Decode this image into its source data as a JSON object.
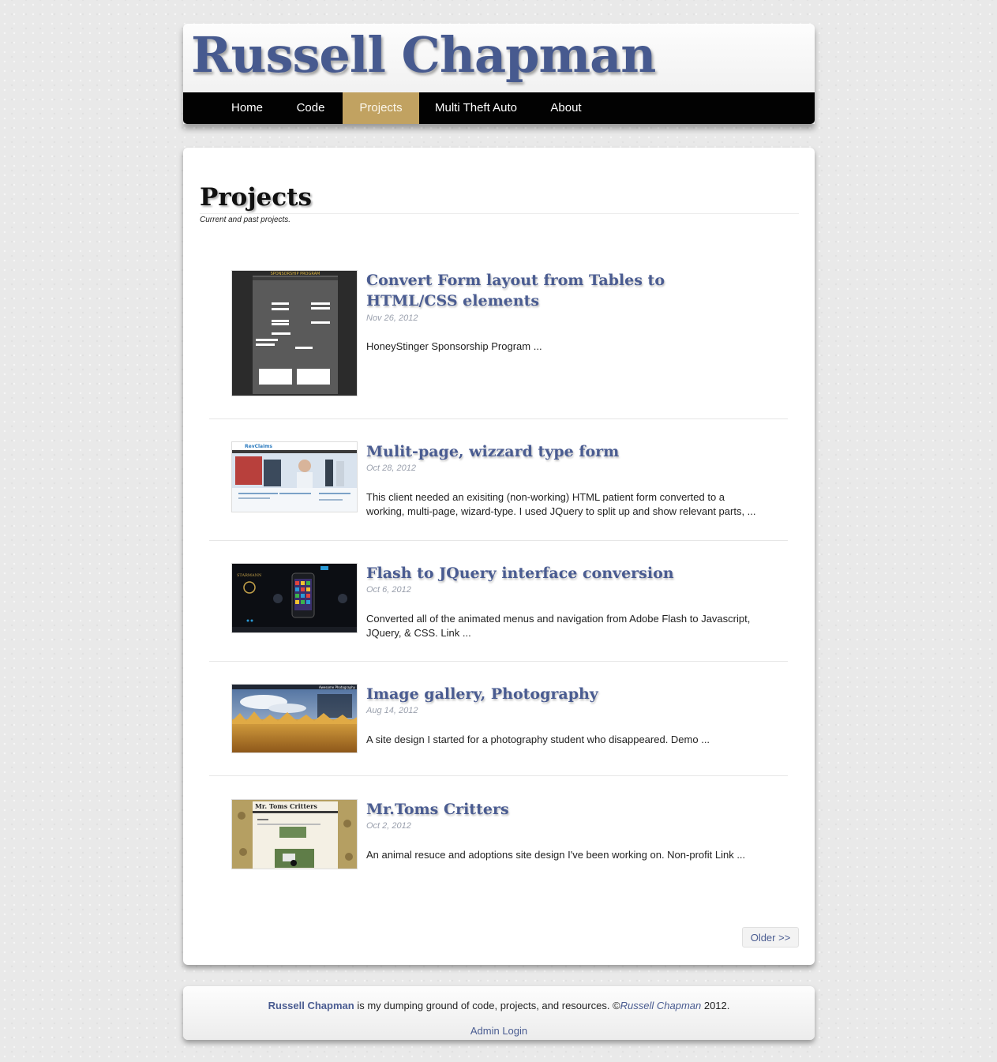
{
  "site": {
    "title": "Russell Chapman"
  },
  "nav": {
    "items": [
      {
        "label": "Home"
      },
      {
        "label": "Code"
      },
      {
        "label": "Projects",
        "active": true
      },
      {
        "label": "Multi Theft Auto"
      },
      {
        "label": "About"
      }
    ]
  },
  "page": {
    "title": "Projects",
    "subtitle": "Current and past projects."
  },
  "posts": [
    {
      "title": "Convert Form layout from Tables to HTML/CSS elements",
      "date": "Nov 26, 2012",
      "excerpt": "HoneyStinger Sponsorship Program ...",
      "thumb_text": "SPONSORSHIP PROGRAM"
    },
    {
      "title": "Mulit-page, wizzard type form",
      "date": "Oct 28, 2012",
      "excerpt": "This client needed an exisiting (non-working) HTML patient form converted to a working, multi-page, wizard-type. I used JQuery to split up and show relevant parts, ...",
      "thumb_text": "RevClaims"
    },
    {
      "title": "Flash to JQuery interface conversion",
      "date": "Oct 6, 2012",
      "excerpt": "Converted all of the animated menus and navigation from Adobe Flash to Javascript, JQuery, & CSS. Link ...",
      "thumb_text": "STARMANN"
    },
    {
      "title": "Image gallery, Photography",
      "date": "Aug 14, 2012",
      "excerpt": "A site design I started for a photography student who disappeared. Demo ...",
      "thumb_text": "Awesome Photography"
    },
    {
      "title": "Mr.Toms Critters",
      "date": "Oct 2, 2012",
      "excerpt": "An animal resuce and adoptions site design I've been working on. Non-profit Link ...",
      "thumb_text": "Mr. Toms Critters"
    }
  ],
  "pagination": {
    "older_label": "Older >>"
  },
  "footer": {
    "brand": "Russell Chapman",
    "text": " is my dumping ground of code, projects, and resources. ©",
    "author": "Russell Chapman",
    "year": " 2012.",
    "admin_label": "Admin Login"
  },
  "colors": {
    "brand_blue": "#4a5c91",
    "nav_active": "#c1a261",
    "nav_bg": "#020202"
  }
}
